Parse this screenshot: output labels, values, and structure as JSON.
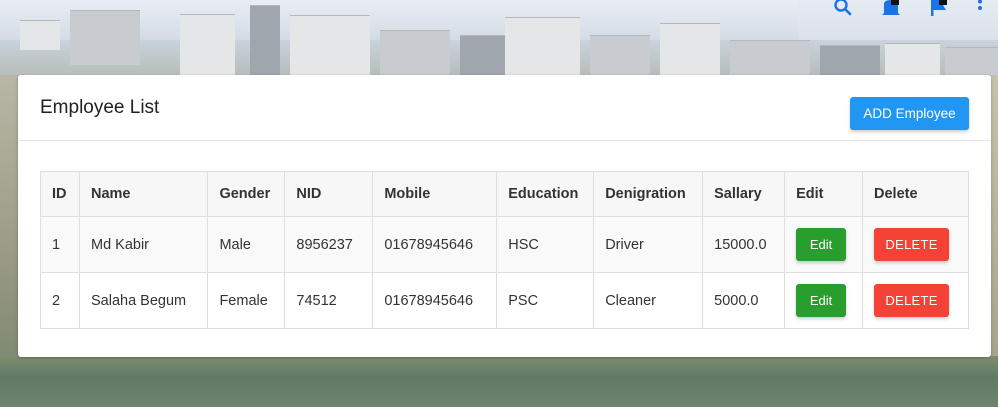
{
  "toolbar": {
    "icons": [
      "search-icon",
      "bell-icon",
      "flag-icon",
      "more-vert-icon"
    ],
    "icon_color": "#1a73e8"
  },
  "card": {
    "title": "Employee List",
    "add_button_label": "ADD Employee"
  },
  "table": {
    "headers": {
      "id": "ID",
      "name": "Name",
      "gender": "Gender",
      "nid": "NID",
      "mobile": "Mobile",
      "education": "Education",
      "designation": "Denigration",
      "salary": "Sallary",
      "edit": "Edit",
      "delete": "Delete"
    },
    "rows": [
      {
        "id": "1",
        "name": "Md Kabir",
        "gender": "Male",
        "nid": "8956237",
        "mobile": "01678945646",
        "education": "HSC",
        "designation": "Driver",
        "salary": "15000.0",
        "edit_label": "Edit",
        "delete_label": "DELETE"
      },
      {
        "id": "2",
        "name": "Salaha Begum",
        "gender": "Female",
        "nid": "74512",
        "mobile": "01678945646",
        "education": "PSC",
        "designation": "Cleaner",
        "salary": "5000.0",
        "edit_label": "Edit",
        "delete_label": "DELETE"
      }
    ]
  },
  "colors": {
    "primary": "#2196f3",
    "edit": "#2a9d2f",
    "delete": "#f44336"
  }
}
